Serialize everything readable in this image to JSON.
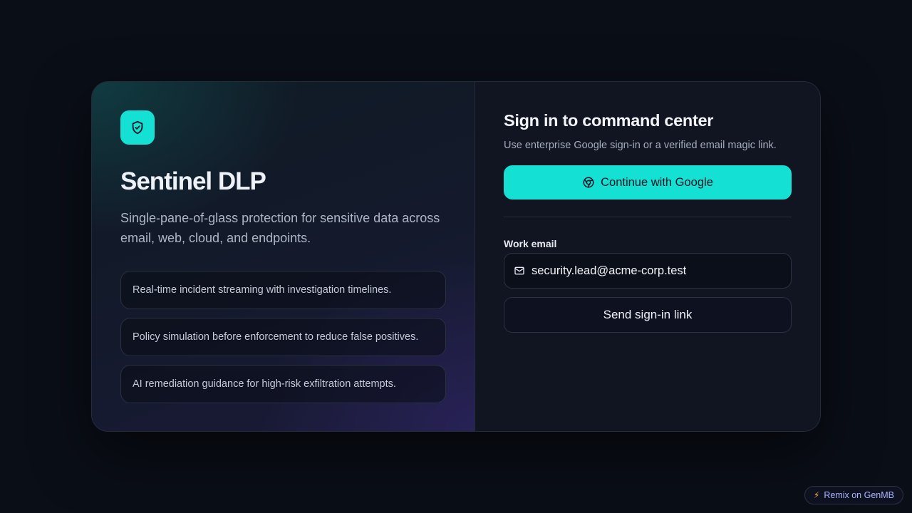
{
  "brand": {
    "name": "Sentinel DLP",
    "tagline": "Single-pane-of-glass protection for sensitive data across email, web, cloud, and endpoints.",
    "logo_icon": "shield-check-icon",
    "accent_color": "#14e0d3"
  },
  "features": [
    {
      "text": "Real-time incident streaming with investigation timelines."
    },
    {
      "text": "Policy simulation before enforcement to reduce false positives."
    },
    {
      "text": "AI remediation guidance for high-risk exfiltration attempts."
    }
  ],
  "signin": {
    "title": "Sign in to command center",
    "subtitle": "Use enterprise Google sign-in or a verified email magic link.",
    "google_label": "Continue with Google",
    "google_icon": "chrome-icon",
    "email_label": "Work email",
    "email_icon": "mail-icon",
    "email_value": "security.lead@acme-corp.test",
    "send_label": "Send sign-in link"
  },
  "remix": {
    "label": "Remix on GenMB",
    "icon": "bolt-icon"
  }
}
